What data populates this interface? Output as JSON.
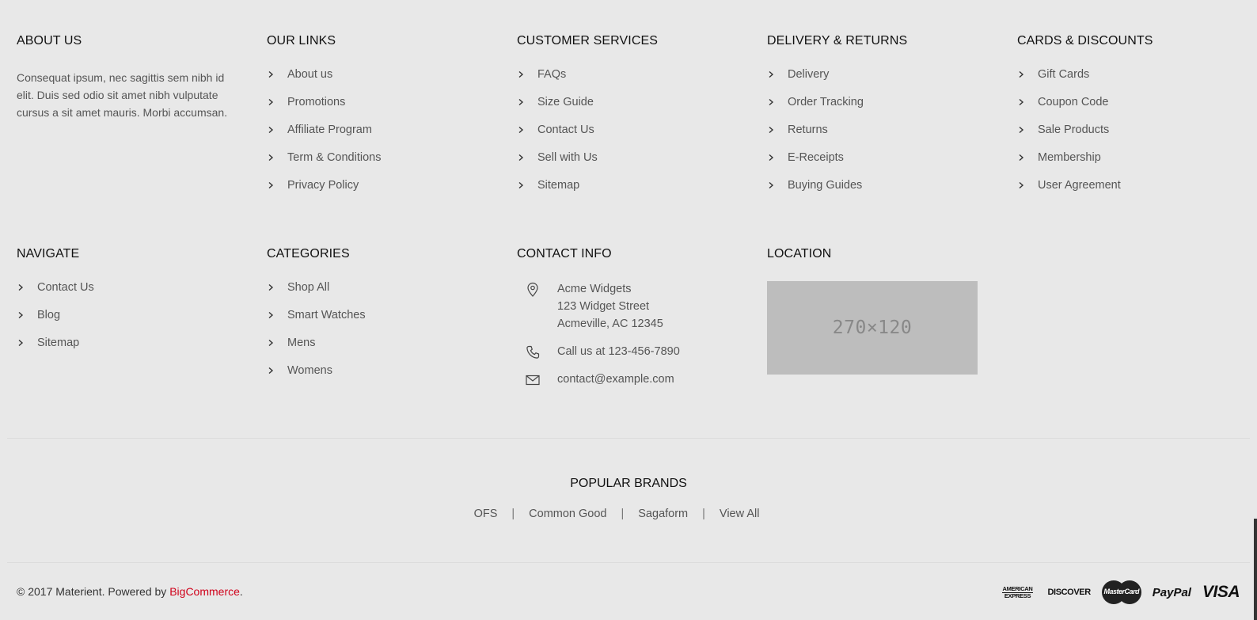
{
  "about": {
    "title": "ABOUT US",
    "text": "Consequat ipsum, nec sagittis sem nibh id elit. Duis sed odio sit amet nibh vulputate cursus a sit amet mauris. Morbi accumsan."
  },
  "our_links": {
    "title": "OUR LINKS",
    "items": [
      "About us",
      "Promotions",
      "Affiliate Program",
      "Term & Conditions",
      "Privacy Policy"
    ]
  },
  "customer_services": {
    "title": "CUSTOMER SERVICES",
    "items": [
      "FAQs",
      "Size Guide",
      "Contact Us",
      "Sell with Us",
      "Sitemap"
    ]
  },
  "delivery_returns": {
    "title": "DELIVERY & RETURNS",
    "items": [
      "Delivery",
      "Order Tracking",
      "Returns",
      "E-Receipts",
      "Buying Guides"
    ]
  },
  "cards_discounts": {
    "title": "CARDS & DISCOUNTS",
    "items": [
      "Gift Cards",
      "Coupon Code",
      "Sale Products",
      "Membership",
      "User Agreement"
    ]
  },
  "navigate": {
    "title": "NAVIGATE",
    "items": [
      "Contact Us",
      "Blog",
      "Sitemap"
    ]
  },
  "categories": {
    "title": "CATEGORIES",
    "items": [
      "Shop All",
      "Smart Watches",
      "Mens",
      "Womens"
    ]
  },
  "contact_info": {
    "title": "CONTACT INFO",
    "address_line1": "Acme Widgets",
    "address_line2": "123 Widget Street",
    "address_line3": "Acmeville, AC 12345",
    "phone": "Call us at 123-456-7890",
    "email": "contact@example.com"
  },
  "location": {
    "title": "LOCATION",
    "map_placeholder": "270×120"
  },
  "popular_brands": {
    "title": "POPULAR BRANDS",
    "items": [
      "OFS",
      "Common Good",
      "Sagaform",
      "View All"
    ],
    "separator": "|"
  },
  "footer": {
    "copyright_prefix": "© 2017 Materient. Powered by ",
    "powered_link": "BigCommerce",
    "copyright_suffix": ".",
    "payment_methods": [
      "american-express-icon",
      "discover-icon",
      "mastercard-icon",
      "paypal-icon",
      "visa-icon"
    ],
    "amex_line1": "AMERICAN",
    "amex_line2": "EXPRESS",
    "discover": "DISCOVER",
    "mastercard": "MasterCard",
    "paypal": "PayPal",
    "visa": "VISA",
    "link_color": "#d0021b"
  }
}
